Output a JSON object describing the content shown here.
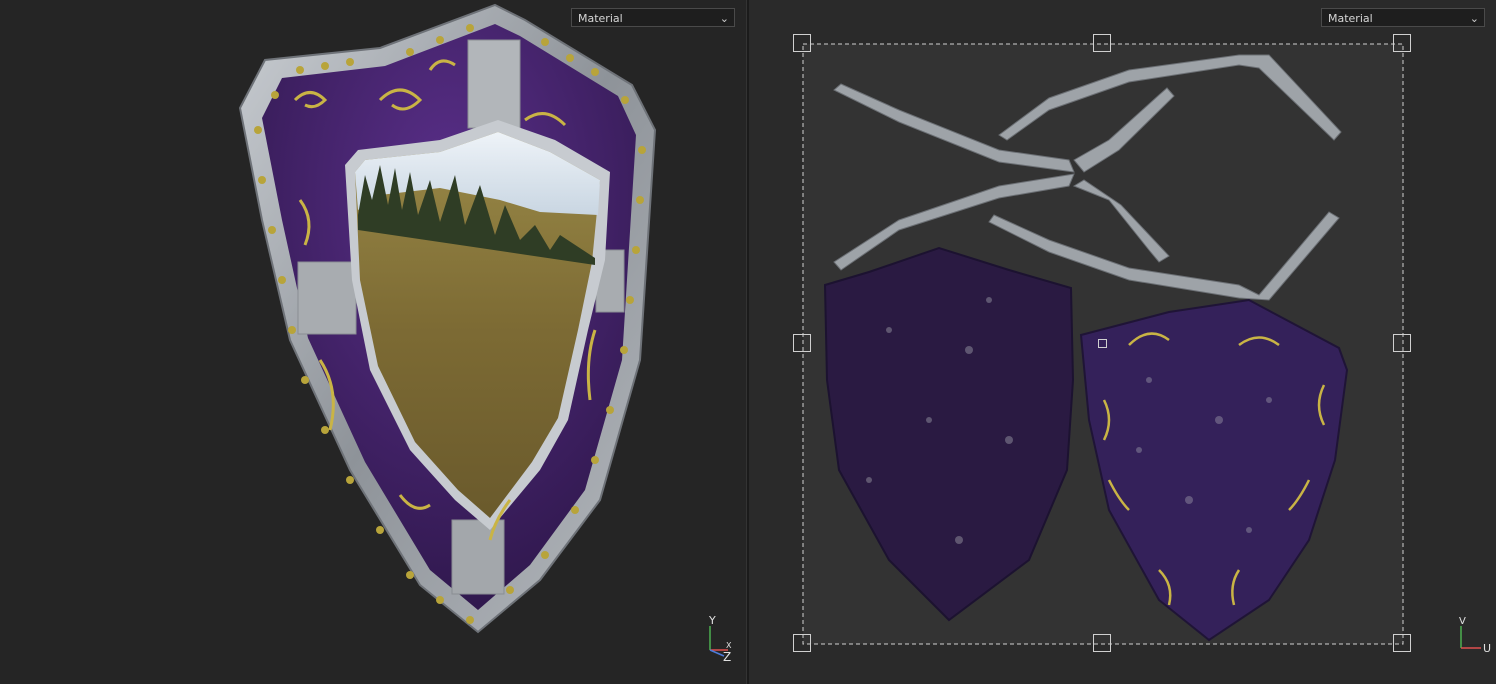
{
  "viewport_3d": {
    "material_dropdown": {
      "selected": "Material"
    },
    "axis_gizmo": {
      "up_label": "Y",
      "x_label": "X",
      "z_label": "Z"
    }
  },
  "viewport_2d": {
    "material_dropdown": {
      "selected": "Material"
    },
    "axis_gizmo": {
      "v_label": "V",
      "u_label": "U"
    }
  },
  "colors": {
    "viewport_bg": "#252525",
    "uv_tile_bg": "#3a3a3a",
    "shield_purple": "#3b1f5e",
    "metal_rim": "#a8adb3",
    "gold_trim": "#b8a43a"
  },
  "icons": [
    "chevron-down-icon",
    "axis-gizmo-icon",
    "transform-handle-icon"
  ]
}
